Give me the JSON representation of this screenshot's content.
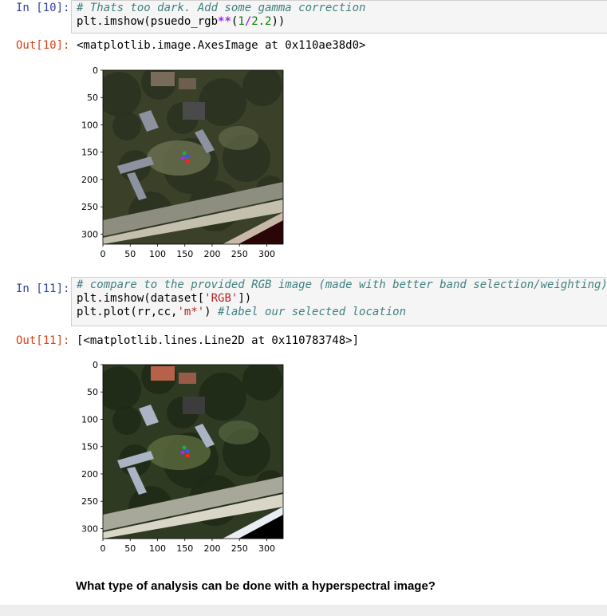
{
  "cells": [
    {
      "in_prompt": "In [10]:",
      "code_lines": [
        [
          {
            "t": "# Thats too dark. Add some gamma correction",
            "c": "c-comment"
          }
        ],
        [
          {
            "t": "plt.imshow(psuedo_rgb",
            "c": "c-plain"
          },
          {
            "t": "**",
            "c": "c-op"
          },
          {
            "t": "(",
            "c": "c-plain"
          },
          {
            "t": "1",
            "c": "c-num"
          },
          {
            "t": "/",
            "c": "c-op"
          },
          {
            "t": "2.2",
            "c": "c-num"
          },
          {
            "t": "))",
            "c": "c-plain"
          }
        ]
      ],
      "out_prompt": "Out[10]:",
      "out_text": "<matplotlib.image.AxesImage at 0x110ae38d0>",
      "plot": {
        "yticks": [
          "0",
          "50",
          "100",
          "150",
          "200",
          "250",
          "300"
        ],
        "xticks": [
          "0",
          "50",
          "100",
          "150",
          "200",
          "250",
          "300"
        ]
      }
    },
    {
      "in_prompt": "In [11]:",
      "code_lines": [
        [
          {
            "t": "# compare to the provided RGB image (made with better band selection/weighting)",
            "c": "c-comment"
          }
        ],
        [
          {
            "t": "plt.imshow(dataset[",
            "c": "c-plain"
          },
          {
            "t": "'RGB'",
            "c": "c-str"
          },
          {
            "t": "])",
            "c": "c-plain"
          }
        ],
        [
          {
            "t": "plt.plot(rr,cc,",
            "c": "c-plain"
          },
          {
            "t": "'m*'",
            "c": "c-str"
          },
          {
            "t": ") ",
            "c": "c-plain"
          },
          {
            "t": "#label our selected location",
            "c": "c-comment"
          }
        ]
      ],
      "out_prompt": "Out[11]:",
      "out_text": "[<matplotlib.lines.Line2D at 0x110783748>]",
      "plot": {
        "yticks": [
          "0",
          "50",
          "100",
          "150",
          "200",
          "250",
          "300"
        ],
        "xticks": [
          "0",
          "50",
          "100",
          "150",
          "200",
          "250",
          "300"
        ]
      }
    }
  ],
  "markdown_heading": "What type of analysis can be done with a hyperspectral image?",
  "colors": {
    "in_prompt": "#303f9f",
    "out_prompt": "#d84315",
    "cell_bg": "#f5f5f5",
    "cell_border": "#cfcfcf"
  }
}
